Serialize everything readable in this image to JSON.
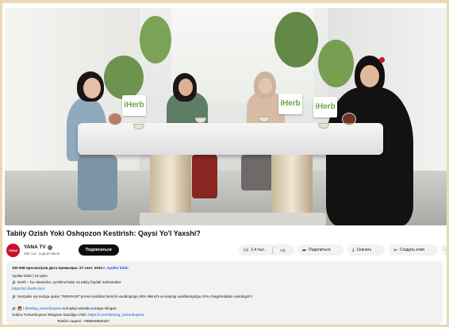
{
  "video": {
    "brand_text": "iHerb"
  },
  "title": "Tabiiy Ozish Yoki Oshqozon Kestirish: Qaysi Yo'l Yaxshi?",
  "channel": {
    "avatar_text": "YANA",
    "name": "YANA TV",
    "subscribers": "268 тыс. подписчиков",
    "subscribe_label": "Подписаться"
  },
  "actions": {
    "like_count": "2,4 тыс.",
    "share_label": "Поделиться",
    "save_label": "Скачать",
    "clip_label": "Создать клип",
    "more_label": "···"
  },
  "icons": {
    "like": "thumbs-up-icon",
    "dislike": "thumbs-down-icon",
    "share": "share-arrow-icon",
    "save": "download-icon",
    "clip": "scissors-icon",
    "verified": "check-circle-icon"
  },
  "description": {
    "stats": "100 608 просмотров  Дата премьеры: 27 сент. 2024 г.",
    "stats_tag": "Ayollar klubi",
    "line1": "Ayollar klubi | 16-qism",
    "line2": "🔊 iHerb – bu vitaminlar, qo'shimchalar va tabiiy foydali mahsulotlar.",
    "line3_link": "https://uz.iherb.com/",
    "line4": "🔊 Sentyabr oyi oxiriga qadar \"INDIRA28\" promo kodidan birinchi xaridingizga 28% ikkinchi va keyingi xaridlaringizga 10% chegirmalidan xaridingiz!!!",
    "line5_prefix": "🔊 👩 / ",
    "line5_link": "dietolog_tursunboyeva",
    "line5_suffix": "  somiyligi asosida suratga olingan.",
    "line6_prefix": "Sobira Tursunboyeva Telegram kanaliga o'tish: ",
    "line6_link": "https://t.me/dietolog_tursunboyeva",
    "line7": "Telefon raqami: +998949505337"
  },
  "colors": {
    "background_frame": "#ead9b5",
    "subscribe_bg": "#0f0f0f",
    "link": "#065fd4",
    "avatar": "#c8102e",
    "pill_bg": "#f2f2f2"
  }
}
